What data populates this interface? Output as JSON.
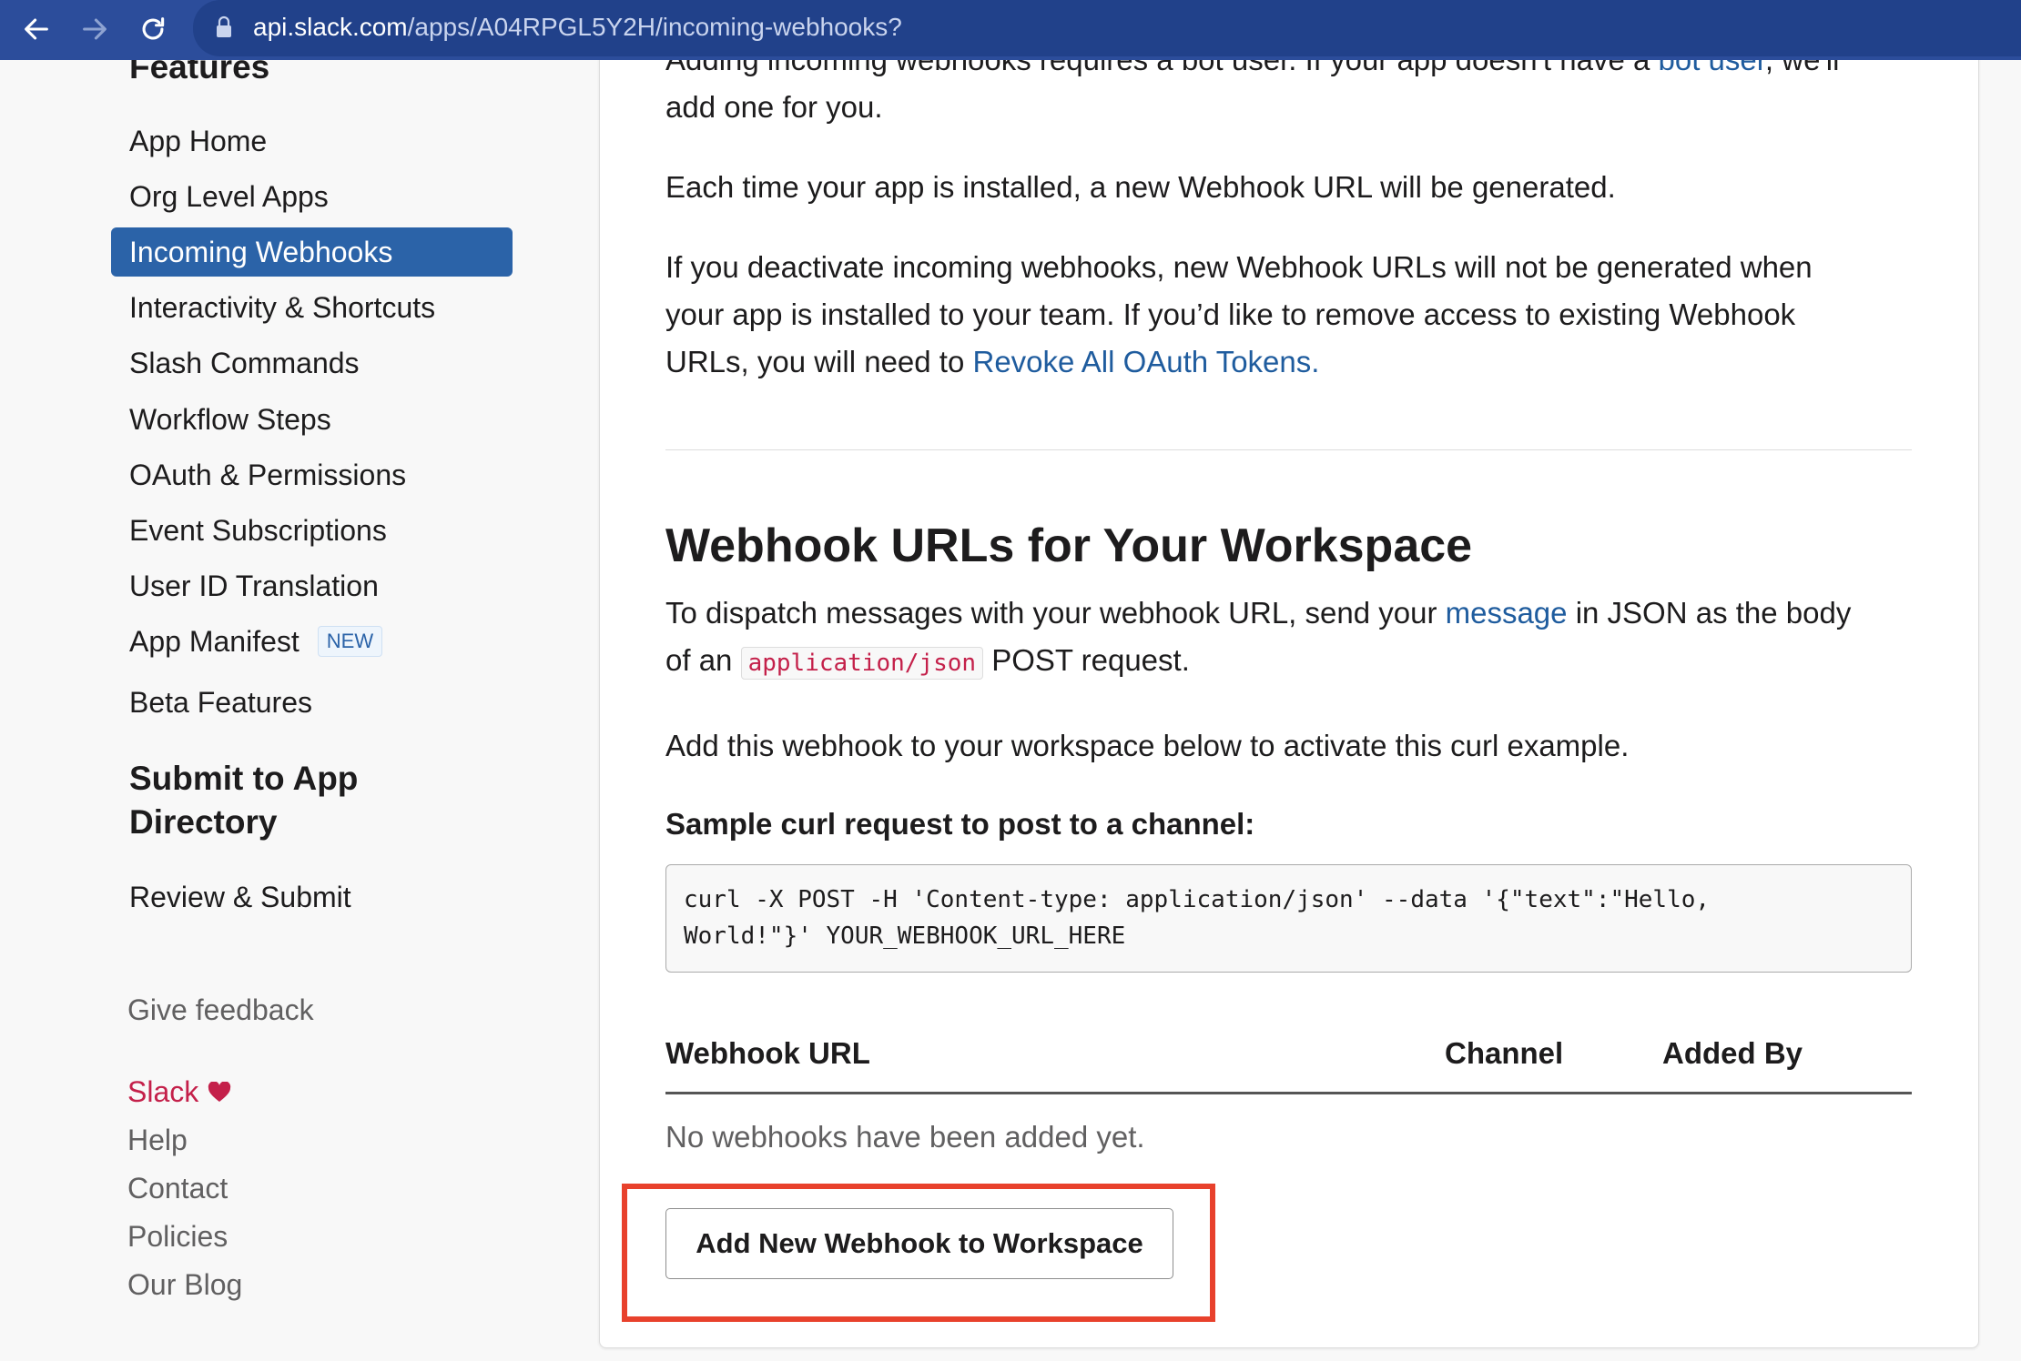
{
  "browser": {
    "url_host": "api.slack.com",
    "url_path": "/apps/A04RPGL5Y2H/incoming-webhooks?",
    "icons": [
      "back-arrow-icon",
      "forward-arrow-icon",
      "reload-icon",
      "lock-icon"
    ]
  },
  "sidebar": {
    "features_heading": "Features",
    "items": [
      {
        "label": "App Home"
      },
      {
        "label": "Org Level Apps"
      },
      {
        "label": "Incoming Webhooks",
        "active": true
      },
      {
        "label": "Interactivity & Shortcuts"
      },
      {
        "label": "Slash Commands"
      },
      {
        "label": "Workflow Steps"
      },
      {
        "label": "OAuth & Permissions"
      },
      {
        "label": "Event Subscriptions"
      },
      {
        "label": "User ID Translation"
      },
      {
        "label": "App Manifest",
        "badge": "NEW"
      },
      {
        "label": "Beta Features"
      }
    ],
    "submit_heading_line1": "Submit to App",
    "submit_heading_line2": "Directory",
    "review_submit": "Review & Submit",
    "give_feedback": "Give feedback",
    "footer": {
      "slack": "Slack",
      "help": "Help",
      "contact": "Contact",
      "policies": "Policies",
      "blog": "Our Blog"
    }
  },
  "main": {
    "intro_cut_line": "Adding incoming webhooks requires a bot user. If your app doesn't have a",
    "intro_cut_link": "bot user",
    "intro_cut_tail": ", we'll",
    "intro_line2": "add one for you.",
    "install_para": "Each time your app is installed, a new Webhook URL will be generated.",
    "deactivate_line1": "If you deactivate incoming webhooks, new Webhook URLs will not be generated when",
    "deactivate_line2": "your app is installed to your team. If you’d like to remove access to existing Webhook",
    "deactivate_line3_pre": "URLs, you will need to",
    "revoke_link": "Revoke All OAuth Tokens.",
    "section_title": "Webhook URLs for Your Workspace",
    "dispatch_pre": "To dispatch messages with your webhook URL, send your",
    "dispatch_link": "message",
    "dispatch_post": "in JSON as the body",
    "dispatch_line2_pre": "of an",
    "dispatch_code": "application/json",
    "dispatch_line2_post": "POST request.",
    "add_para": "Add this webhook to your workspace below to activate this curl example.",
    "curl_label": "Sample curl request to post to a channel:",
    "curl_code": "curl -X POST -H 'Content-type: application/json' --data '{\"text\":\"Hello,\nWorld!\"}' YOUR_WEBHOOK_URL_HERE",
    "table": {
      "headers": [
        "Webhook URL",
        "Channel",
        "Added By"
      ],
      "empty": "No webhooks have been added yet."
    },
    "add_button": "Add New Webhook to Workspace"
  },
  "colors": {
    "browser_bar": "#2c4d9b",
    "active_nav": "#2b63a8",
    "link": "#1f5c9e",
    "slack_red": "#c4204a",
    "highlight": "#e8412c"
  }
}
